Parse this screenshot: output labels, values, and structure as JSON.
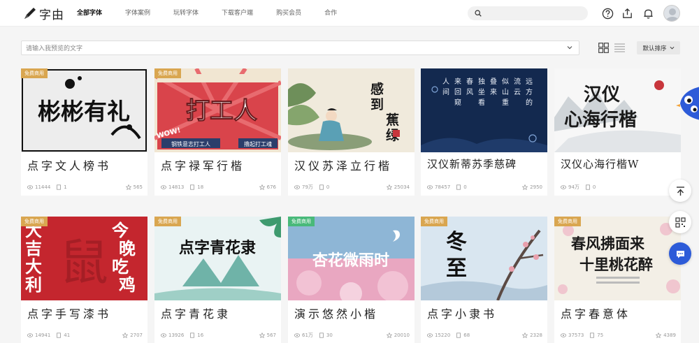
{
  "header": {
    "logo_text": "字由",
    "nav": [
      "全部字体",
      "字体案例",
      "玩转字体",
      "下载客户端",
      "购买会员",
      "合作"
    ],
    "search_placeholder": ""
  },
  "filter": {
    "placeholder": "请输入我预览的文字",
    "sort_label": "默认排序"
  },
  "cards": [
    {
      "name": "点字文人榜书",
      "badge": "免费商用",
      "views": "11444",
      "downloads": "1",
      "favs": "565",
      "thumb_text": "彬彬有礼"
    },
    {
      "name": "点字禄军行楷",
      "badge": "免费商用",
      "views": "14813",
      "downloads": "18",
      "favs": "676",
      "thumb_text": "打工人",
      "thumb_sub": "钢铁意志打工人",
      "thumb_sub2": "撸起打工魂",
      "thumb_wow": "WOW!"
    },
    {
      "name": "汉仪苏泽立行楷",
      "badge": "",
      "views": "79万",
      "downloads": "0",
      "favs": "25034",
      "thumb_text": "感到蕉绿"
    },
    {
      "name": "汉仪新蒂苏季慈碑",
      "badge": "",
      "views": "78457",
      "downloads": "0",
      "favs": "2950",
      "thumb_text": "远方的流云 似山重叠来 独坐看春风 来回窥人间"
    },
    {
      "name": "汉仪心海行楷W",
      "badge": "",
      "views": "94万",
      "downloads": "0",
      "favs": "",
      "thumb_text": "汉仪心海行楷"
    },
    {
      "name": "点字手写漆书",
      "badge": "免费商用",
      "views": "14941",
      "downloads": "41",
      "favs": "2707",
      "thumb_text": "今晚吃鸡",
      "thumb_left": "大吉大利"
    },
    {
      "name": "点字青花隶",
      "badge": "免费商用",
      "views": "13926",
      "downloads": "16",
      "favs": "567",
      "thumb_text": "点字青花隶"
    },
    {
      "name": "演示悠然小楷",
      "badge": "免费商用",
      "views": "61万",
      "downloads": "30",
      "favs": "20010",
      "thumb_text": "杏花微雨时"
    },
    {
      "name": "点字小隶书",
      "badge": "免费商用",
      "views": "15220",
      "downloads": "68",
      "favs": "2328",
      "thumb_text": "冬至"
    },
    {
      "name": "点字春意体",
      "badge": "免费商用",
      "views": "37573",
      "downloads": "75",
      "favs": "4389",
      "thumb_text": "春风拂面来 十里桃花醉"
    }
  ],
  "colors": {
    "badge_gold": "#d9a650",
    "badge_green": "#49b97a",
    "accent_blue": "#2d5bd8"
  }
}
